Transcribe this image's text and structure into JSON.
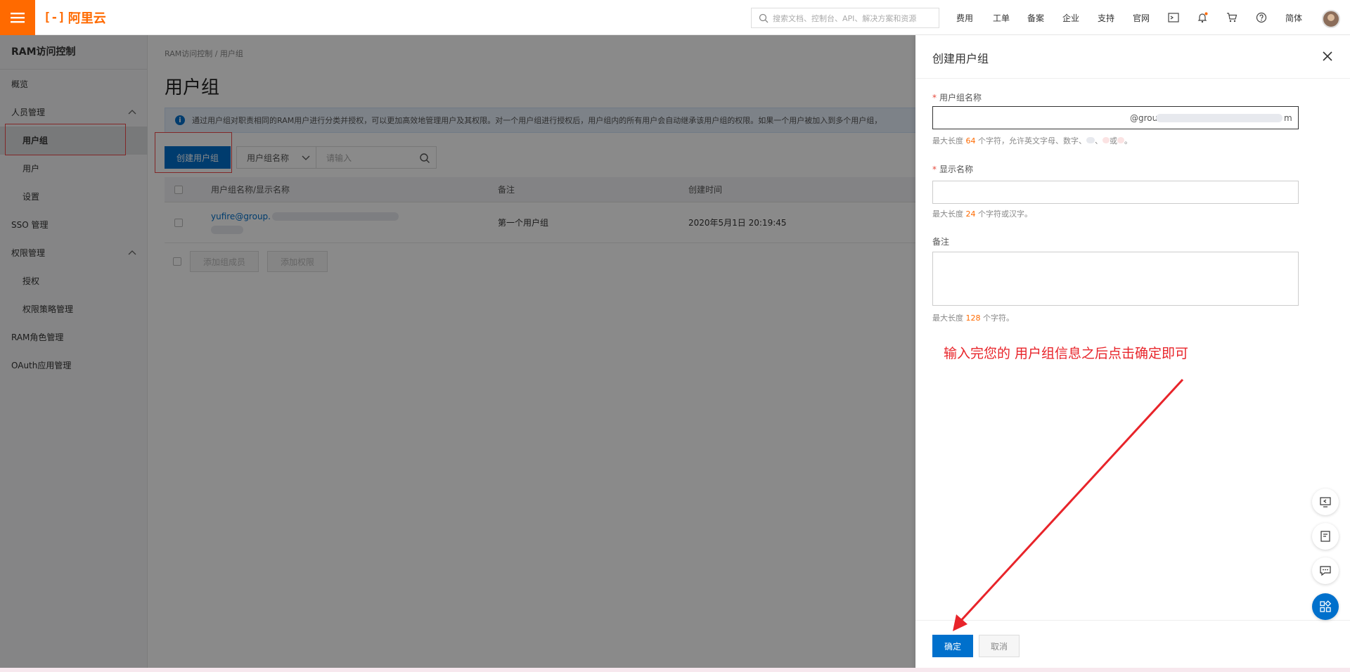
{
  "topbar": {
    "logo_mark": "[-]",
    "logo_text": "阿里云",
    "search_placeholder": "搜索文档、控制台、API、解决方案和资源",
    "nav": [
      "费用",
      "工单",
      "备案",
      "企业",
      "支持",
      "官网"
    ],
    "lang": "简体",
    "icons": [
      "terminal-icon",
      "bell-icon",
      "cart-icon",
      "help-icon"
    ]
  },
  "sidebar": {
    "title": "RAM访问控制",
    "items": [
      {
        "label": "概览"
      },
      {
        "label": "人员管理"
      },
      {
        "label": "用户组"
      },
      {
        "label": "用户"
      },
      {
        "label": "设置"
      },
      {
        "label": "SSO 管理"
      },
      {
        "label": "权限管理"
      },
      {
        "label": "授权"
      },
      {
        "label": "权限策略管理"
      },
      {
        "label": "RAM角色管理"
      },
      {
        "label": "OAuth应用管理"
      }
    ]
  },
  "main": {
    "breadcrumb": "RAM访问控制  /  用户组",
    "title": "用户组",
    "info": "通过用户组对职责相同的RAM用户进行分类并授权，可以更加高效地管理用户及其权限。对一个用户组进行授权后，用户组内的所有用户会自动继承该用户组的权限。如果一个用户被加入到多个用户组，",
    "create_button": "创建用户组",
    "filter_select": "用户组名称",
    "filter_placeholder": "请输入",
    "columns": [
      "用户组名称/显示名称",
      "备注",
      "创建时间"
    ],
    "rows": [
      {
        "name": "yufire@group.",
        "remark": "第一个用户组",
        "created": "2020年5月1日 20:19:45"
      }
    ],
    "footer_buttons": [
      "添加组成员",
      "添加权限"
    ]
  },
  "drawer": {
    "title": "创建用户组",
    "group_name_label": "用户组名称",
    "group_name_value": "@grou",
    "group_name_value_end": "m",
    "group_name_hint": {
      "pre": "最大长度 ",
      "num": "64",
      "post": " 个字符，允许英文字母、数字、",
      "sep": "、",
      "mid": "或",
      "end": "。"
    },
    "display_label": "显示名称",
    "display_hint": {
      "pre": "最大长度 ",
      "num": "24",
      "post": " 个字符或汉字。"
    },
    "remark_label": "备注",
    "remark_hint": {
      "pre": "最大长度 ",
      "num": "128",
      "post": " 个字符。"
    },
    "annotation": "输入完您的 用户组信息之后点击确定即可",
    "ok": "确定",
    "cancel": "取消"
  },
  "colors": {
    "brand": "#ff6a00",
    "primary": "#0070cc",
    "annotation": "#e8242a"
  }
}
